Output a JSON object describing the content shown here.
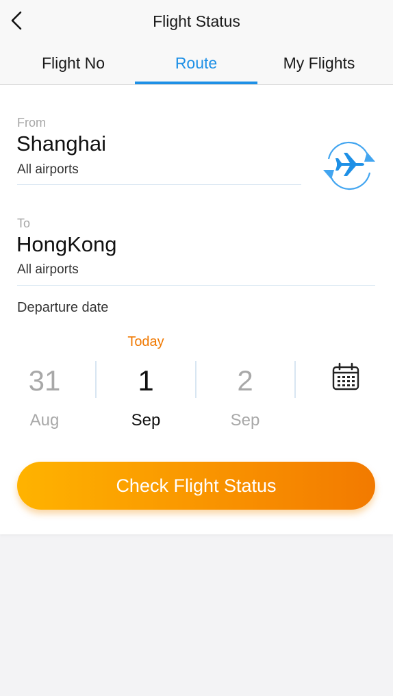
{
  "header": {
    "title": "Flight Status"
  },
  "tabs": [
    {
      "label": "Flight No",
      "active": false
    },
    {
      "label": "Route",
      "active": true
    },
    {
      "label": "My Flights",
      "active": false
    }
  ],
  "from": {
    "label": "From",
    "city": "Shanghai",
    "airports": "All airports"
  },
  "to": {
    "label": "To",
    "city": "HongKong",
    "airports": "All airports"
  },
  "departure": {
    "label": "Departure date",
    "today_label": "Today",
    "dates": [
      {
        "day": "31",
        "month": "Aug",
        "selected": false
      },
      {
        "day": "1",
        "month": "Sep",
        "selected": true
      },
      {
        "day": "2",
        "month": "Sep",
        "selected": false
      }
    ]
  },
  "action": {
    "label": "Check Flight Status"
  },
  "icons": {
    "back": "chevron-left-icon",
    "swap": "airplane-swap-icon",
    "calendar": "calendar-icon"
  },
  "colors": {
    "accent": "#1e90e6",
    "today": "#f07800",
    "button_start": "#ffb300",
    "button_end": "#f27a00"
  }
}
